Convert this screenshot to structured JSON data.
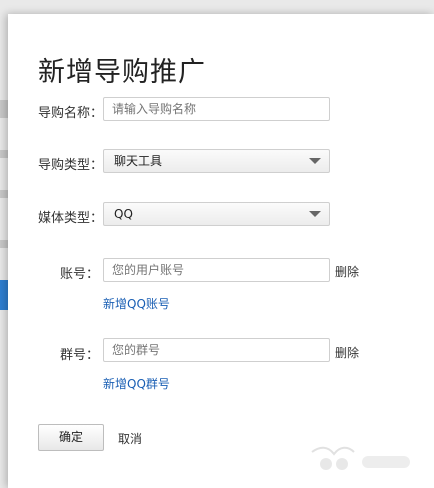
{
  "modal": {
    "title": "新增导购推广",
    "fields": {
      "name": {
        "label": "导购名称：",
        "placeholder": "请输入导购名称"
      },
      "guide_type": {
        "label": "导购类型：",
        "value": "聊天工具"
      },
      "media_type": {
        "label": "媒体类型：",
        "value": "QQ"
      },
      "account": {
        "label": "账号：",
        "placeholder": "您的用户账号",
        "delete": "删除",
        "add_link": "新增QQ账号"
      },
      "group": {
        "label": "群号：",
        "placeholder": "您的群号",
        "delete": "删除",
        "add_link": "新增QQ群号"
      }
    },
    "buttons": {
      "ok": "确定",
      "cancel": "取消"
    }
  },
  "icons": {
    "dropdown": "chevron-down-icon"
  }
}
